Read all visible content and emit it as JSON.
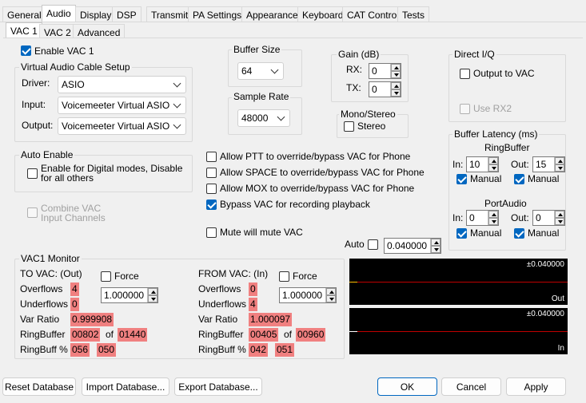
{
  "main_tabs": [
    "General",
    "Audio",
    "Display",
    "DSP",
    "Transmit",
    "PA Settings",
    "Appearance",
    "Keyboard",
    "CAT Control",
    "Tests"
  ],
  "sub_tabs": [
    "VAC 1",
    "VAC 2",
    "Advanced"
  ],
  "enable_vac": "Enable VAC 1",
  "vac_setup": {
    "title": "Virtual Audio Cable Setup",
    "driver_label": "Driver:",
    "driver_value": "ASIO",
    "input_label": "Input:",
    "input_value": "Voicemeeter Virtual ASIO",
    "output_label": "Output:",
    "output_value": "Voicemeeter Virtual ASIO"
  },
  "buffer_size": {
    "title": "Buffer Size",
    "value": "64"
  },
  "sample_rate": {
    "title": "Sample Rate",
    "value": "48000"
  },
  "gain": {
    "title": "Gain (dB)",
    "rx_label": "RX:",
    "rx_value": "0",
    "tx_label": "TX:",
    "tx_value": "0"
  },
  "mono_stereo": {
    "title": "Mono/Stereo",
    "stereo_label": "Stereo"
  },
  "direct_iq": {
    "title": "Direct I/Q",
    "output_label": "Output to VAC",
    "use_rx2_label": "Use RX2"
  },
  "auto_enable": {
    "title": "Auto Enable",
    "option_label_1": "Enable for Digital modes, Disable",
    "option_label_2": "for all others"
  },
  "combine_vac": {
    "label_1": "Combine VAC",
    "label_2": "Input Channels"
  },
  "options": [
    "Allow PTT to override/bypass VAC for Phone",
    "Allow SPACE to override/bypass VAC for Phone",
    "Allow MOX to override/bypass VAC for Phone",
    "Bypass VAC for recording playback"
  ],
  "mute_label": "Mute will mute VAC",
  "auto": {
    "label": "Auto",
    "value": "0.040000"
  },
  "buffer_latency": {
    "title": "Buffer Latency (ms)",
    "ringbuffer_title": "RingBuffer",
    "rb_in_label": "In:",
    "rb_in_value": "10",
    "rb_out_label": "Out:",
    "rb_out_value": "15",
    "manual_label": "Manual",
    "portaudio_title": "PortAudio",
    "pa_in_label": "In:",
    "pa_in_value": "0",
    "pa_out_label": "Out:",
    "pa_out_value": "0"
  },
  "monitor": {
    "title": "VAC1 Monitor",
    "force_label": "Force",
    "labels": {
      "overflows": "Overflows",
      "underflows": "Underflows",
      "var_ratio": "Var Ratio",
      "ringbuffer": "RingBuffer",
      "ringbuff_pct": "RingBuff %",
      "of": "of"
    },
    "to_vac": {
      "title": "TO VAC: (Out)",
      "spin_value": "1.000000",
      "overflows": "4",
      "underflows": "0",
      "var_ratio": "0.999908",
      "rb_a": "00802",
      "rb_b": "01440",
      "pct_a": "056",
      "pct_b": "050"
    },
    "from_vac": {
      "title": "FROM VAC: (In)",
      "spin_value": "1.000000",
      "overflows": "0",
      "underflows": "4",
      "var_ratio": "1.000097",
      "rb_a": "00405",
      "rb_b": "00960",
      "pct_a": "042",
      "pct_b": "051"
    }
  },
  "scopes": [
    {
      "value": "±0.040000",
      "label": "Out"
    },
    {
      "value": "±0.040000",
      "label": "In"
    }
  ],
  "buttons": {
    "reset": "Reset Database",
    "import": "Import Database...",
    "export": "Export Database...",
    "ok": "OK",
    "cancel": "Cancel",
    "apply": "Apply"
  },
  "colors": {
    "accent": "#0067c0",
    "highlight": "#f08080",
    "scope_bg": "#000000",
    "scope_line": "#c00000"
  }
}
